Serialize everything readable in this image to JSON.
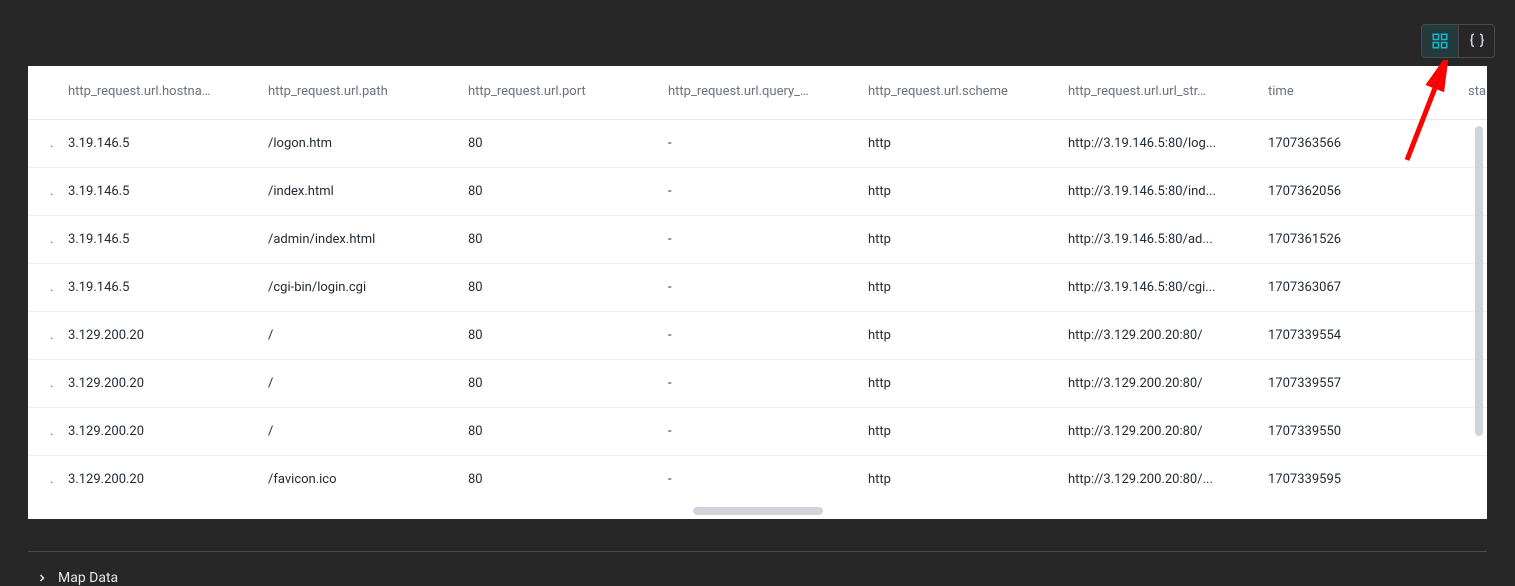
{
  "viewToggle": {
    "grid": "grid",
    "braces": "braces"
  },
  "columns": [
    "http_request.url.hostna…",
    "http_request.url.path",
    "http_request.url.port",
    "http_request.url.query_…",
    "http_request.url.scheme",
    "http_request.url.url_str…",
    "time",
    "sta"
  ],
  "rows": [
    {
      "dot": ".",
      "host": "3.19.146.5",
      "path": "/logon.htm",
      "port": "80",
      "query": "-",
      "scheme": "http",
      "urlstr": "http://3.19.146.5:80/log...",
      "time": "1707363566"
    },
    {
      "dot": ".",
      "host": "3.19.146.5",
      "path": "/index.html",
      "port": "80",
      "query": "-",
      "scheme": "http",
      "urlstr": "http://3.19.146.5:80/ind...",
      "time": "1707362056"
    },
    {
      "dot": ".",
      "host": "3.19.146.5",
      "path": "/admin/index.html",
      "port": "80",
      "query": "-",
      "scheme": "http",
      "urlstr": "http://3.19.146.5:80/ad...",
      "time": "1707361526"
    },
    {
      "dot": ".",
      "host": "3.19.146.5",
      "path": "/cgi-bin/login.cgi",
      "port": "80",
      "query": "-",
      "scheme": "http",
      "urlstr": "http://3.19.146.5:80/cgi...",
      "time": "1707363067"
    },
    {
      "dot": ".",
      "host": "3.129.200.20",
      "path": "/",
      "port": "80",
      "query": "-",
      "scheme": "http",
      "urlstr": "http://3.129.200.20:80/",
      "time": "1707339554"
    },
    {
      "dot": ".",
      "host": "3.129.200.20",
      "path": "/",
      "port": "80",
      "query": "-",
      "scheme": "http",
      "urlstr": "http://3.129.200.20:80/",
      "time": "1707339557"
    },
    {
      "dot": ".",
      "host": "3.129.200.20",
      "path": "/",
      "port": "80",
      "query": "-",
      "scheme": "http",
      "urlstr": "http://3.129.200.20:80/",
      "time": "1707339550"
    },
    {
      "dot": ".",
      "host": "3.129.200.20",
      "path": "/favicon.ico",
      "port": "80",
      "query": "-",
      "scheme": "http",
      "urlstr": "http://3.129.200.20:80/...",
      "time": "1707339595"
    }
  ],
  "section": {
    "title": "Map Data"
  },
  "colors": {
    "accent": "#18b6c9",
    "arrow": "#ff0000"
  }
}
